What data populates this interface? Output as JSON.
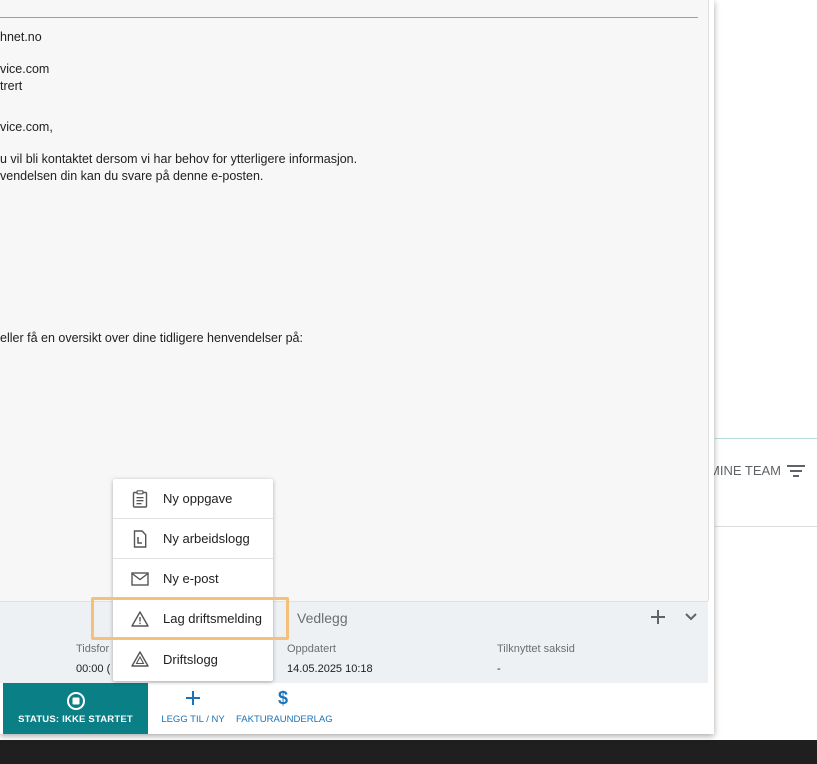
{
  "email": {
    "lines": [
      "hnet.no",
      "vice.com",
      "trert",
      "vice.com,",
      "u vil bli kontaktet dersom vi har behov for ytterligere informasjon.",
      "vendelsen din kan du svare på denne e-posten.",
      "eller få en oversikt over dine tidligere henvendelser på:"
    ]
  },
  "attachments": {
    "label": "Vedlegg",
    "add_icon": "plus-icon",
    "expand_icon": "chevron-down-icon"
  },
  "info": {
    "cols": [
      {
        "label": "Tidsfor",
        "value": "00:00 ("
      },
      {
        "label": "Oppdatert",
        "value": "14.05.2025 10:18"
      },
      {
        "label": "Tilknyttet saksid",
        "value": "-"
      }
    ]
  },
  "toolbar": {
    "status_label": "STATUS: IKKE STARTET",
    "add_label": "LEGG TIL / NY",
    "invoice_label": "FAKTURAUNDERLAG",
    "invoice_symbol": "$"
  },
  "menu": {
    "items": [
      {
        "label": "Ny oppgave",
        "icon": "clipboard-icon"
      },
      {
        "label": "Ny arbeidslogg",
        "icon": "worklog-document-icon"
      },
      {
        "label": "Ny e-post",
        "icon": "envelope-icon"
      },
      {
        "label": "Lag driftsmelding",
        "icon": "warning-icon"
      },
      {
        "label": "Driftslogg",
        "icon": "warning-icon"
      }
    ]
  },
  "background": {
    "team_filter_label": "MINE TEAM"
  },
  "colors": {
    "status_bg": "#0a7f86",
    "action_blue": "#1a73b8",
    "highlight": "#f5c07a"
  }
}
